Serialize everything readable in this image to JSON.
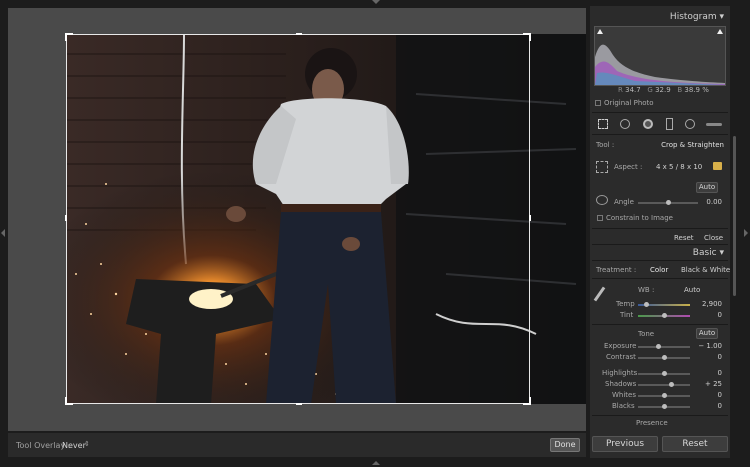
{
  "toolbar": {
    "overlay_label": "Tool Overlay :",
    "overlay_value": "Never",
    "done_label": "Done"
  },
  "histogram": {
    "title": "Histogram",
    "r_label": "R",
    "r_value": "34.7",
    "g_label": "G",
    "g_value": "32.9",
    "b_label": "B",
    "b_value": "38.9",
    "percent": "%",
    "original_photo_label": "Original Photo"
  },
  "crop": {
    "tool_label": "Tool :",
    "tool_name": "Crop & Straighten",
    "aspect_label": "Aspect :",
    "aspect_value": "4 x 5  /  8 x 10",
    "auto_label": "Auto",
    "angle_label": "Angle",
    "angle_value": "0.00",
    "constrain_label": "Constrain to Image",
    "reset_label": "Reset",
    "close_label": "Close"
  },
  "basic": {
    "title": "Basic",
    "treatment_label": "Treatment :",
    "color_label": "Color",
    "bw_label": "Black & White",
    "wb_label": "WB :",
    "wb_value": "Auto",
    "temp_label": "Temp",
    "temp_value": "2,900",
    "tint_label": "Tint",
    "tint_value": "0",
    "tone_label": "Tone",
    "tone_auto_label": "Auto",
    "exposure_label": "Exposure",
    "exposure_value": "− 1.00",
    "contrast_label": "Contrast",
    "contrast_value": "0",
    "highlights_label": "Highlights",
    "highlights_value": "0",
    "shadows_label": "Shadows",
    "shadows_value": "+ 25",
    "whites_label": "Whites",
    "whites_value": "0",
    "blacks_label": "Blacks",
    "blacks_value": "0",
    "presence_label": "Presence"
  },
  "footer": {
    "previous_label": "Previous",
    "reset_label": "Reset"
  }
}
